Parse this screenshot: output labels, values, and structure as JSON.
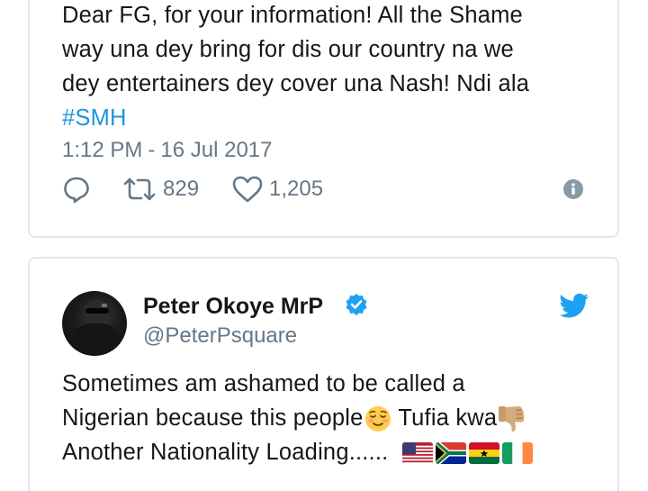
{
  "tweet1": {
    "text_lines": [
      "Dear FG, for your information! All the Shame",
      "way una dey bring for dis our country na we",
      "dey entertainers dey cover una Nash! Ndi ala"
    ],
    "hashtag": "#SMH",
    "time": "1:12 PM",
    "date": "16 Jul 2017",
    "retweets": "829",
    "likes": "1,205",
    "icons": [
      "reply-icon",
      "retweet-icon",
      "heart-icon",
      "info-icon"
    ]
  },
  "tweet2": {
    "display_name": "Peter Okoye MrP",
    "handle": "@PeterPsquare",
    "line1": "Sometimes am ashamed to be called a",
    "line2_a": "Nigerian because this people",
    "line2_b": "Tufia kwa",
    "line3": "Another Nationality Loading......",
    "icons": [
      "verified-icon",
      "twitter-bird-icon",
      "relieved-face-emoji",
      "thumbs-down-emoji"
    ],
    "flags": [
      "us-flag",
      "south-africa-flag",
      "ghana-flag",
      "ireland-flag"
    ]
  },
  "colors": {
    "link": "#1b95e0",
    "muted": "#657786",
    "border": "#e1e8ed",
    "verified": "#1da1f2"
  }
}
